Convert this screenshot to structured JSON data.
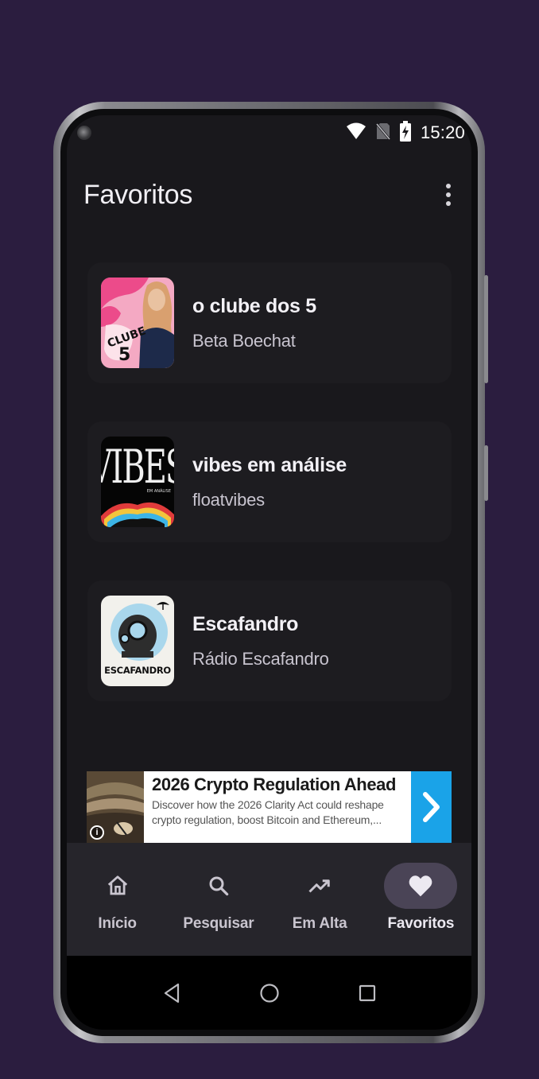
{
  "status_bar": {
    "time": "15:20"
  },
  "app_bar": {
    "title": "Favoritos"
  },
  "favorites": [
    {
      "title": "o clube dos 5",
      "author": "Beta Boechat",
      "cover": "clube-dos-5-cover"
    },
    {
      "title": "vibes em análise",
      "author": "floatvibes",
      "cover": "vibes-cover"
    },
    {
      "title": "Escafandro",
      "author": "Rádio Escafandro",
      "cover": "escafandro-cover"
    }
  ],
  "ad": {
    "title": "2026 Crypto Regulation Ahead",
    "description": "Discover how the 2026 Clarity Act could reshape crypto regulation, boost Bitcoin and Ethereum,...",
    "info_label": "i"
  },
  "bottom_nav": {
    "items": [
      {
        "label": "Início",
        "icon": "home-icon"
      },
      {
        "label": "Pesquisar",
        "icon": "search-icon"
      },
      {
        "label": "Em Alta",
        "icon": "trending-icon"
      },
      {
        "label": "Favoritos",
        "icon": "heart-icon"
      }
    ],
    "active_index": 3
  },
  "colors": {
    "background": "#2b1d3f",
    "screen": "#19181c",
    "card": "#1d1c20",
    "nav_active_pill": "#4a4456",
    "ad_cta": "#1aa3e8"
  }
}
